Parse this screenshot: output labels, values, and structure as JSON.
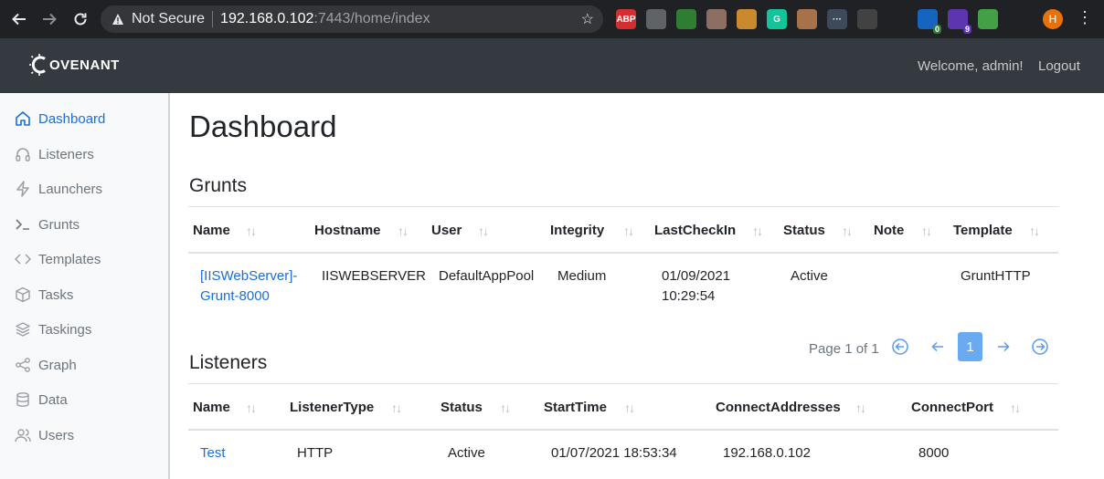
{
  "browser": {
    "security_label": "Not Secure",
    "url_host": "192.168.0.102",
    "url_path": ":7443/home/index",
    "profile_initial": "H",
    "extensions": [
      {
        "name": "adblock-plus-icon",
        "label": "ABP",
        "color": "#d32f2f"
      },
      {
        "name": "extension-cloud-icon",
        "label": "",
        "color": "#5f6368"
      },
      {
        "name": "shield-extension-icon",
        "label": "",
        "color": "#2e7d32"
      },
      {
        "name": "character-extension-icon",
        "label": "",
        "color": "#8d6e63"
      },
      {
        "name": "cookie-icon",
        "label": "",
        "color": "#c98a2f"
      },
      {
        "name": "grammarly-icon",
        "label": "G",
        "color": "#15c39a"
      },
      {
        "name": "cookie-editor-icon",
        "label": "",
        "color": "#a7724a"
      },
      {
        "name": "dots-extension-icon",
        "label": "···",
        "color": "#3c4a5c"
      },
      {
        "name": "extension-box-icon",
        "label": "",
        "color": "#424242"
      },
      {
        "name": "react-devtools-icon",
        "label": "",
        "color": "#202124"
      },
      {
        "name": "network-extension-icon",
        "label": "",
        "color": "#1565c0",
        "badge": "0",
        "badge_color": "#2e7d32"
      },
      {
        "name": "cube-extension-icon",
        "label": "",
        "color": "#5e35b1",
        "badge": "9",
        "badge_color": "#5e35b1"
      },
      {
        "name": "clipboard-extension-icon",
        "label": "",
        "color": "#43a047"
      },
      {
        "name": "puzzle-icon",
        "label": "",
        "color": "#202124"
      }
    ]
  },
  "app": {
    "brand": "OVENANT",
    "welcome_text": "Welcome, admin!",
    "logout_label": "Logout"
  },
  "sidebar": {
    "items": [
      {
        "label": "Dashboard",
        "icon": "home-icon"
      },
      {
        "label": "Listeners",
        "icon": "headphones-icon"
      },
      {
        "label": "Launchers",
        "icon": "lightning-icon"
      },
      {
        "label": "Grunts",
        "icon": "terminal-icon"
      },
      {
        "label": "Templates",
        "icon": "code-icon"
      },
      {
        "label": "Tasks",
        "icon": "box-icon"
      },
      {
        "label": "Taskings",
        "icon": "layers-icon"
      },
      {
        "label": "Graph",
        "icon": "share-icon"
      },
      {
        "label": "Data",
        "icon": "database-icon"
      },
      {
        "label": "Users",
        "icon": "users-icon"
      }
    ]
  },
  "main": {
    "title": "Dashboard",
    "grunts": {
      "heading": "Grunts",
      "columns": [
        "Name",
        "Hostname",
        "User",
        "Integrity",
        "LastCheckIn",
        "Status",
        "Note",
        "Template"
      ],
      "rows": [
        {
          "name_line1": "[IISWebServer]-",
          "name_line2": "Grunt-8000",
          "hostname": "IISWEBSERVER",
          "user": "DefaultAppPool",
          "integrity": "Medium",
          "lastcheckin_line1": "01/09/2021",
          "lastcheckin_line2": "10:29:54",
          "status": "Active",
          "note": "",
          "template": "GruntHTTP"
        }
      ],
      "pager_text": "Page 1 of 1",
      "current_page": "1"
    },
    "listeners": {
      "heading": "Listeners",
      "columns": [
        "Name",
        "ListenerType",
        "Status",
        "StartTime",
        "ConnectAddresses",
        "ConnectPort"
      ],
      "rows": [
        {
          "name": "Test",
          "type": "HTTP",
          "status": "Active",
          "starttime": "01/07/2021 18:53:34",
          "addresses": "192.168.0.102",
          "port": "8000"
        }
      ]
    }
  }
}
